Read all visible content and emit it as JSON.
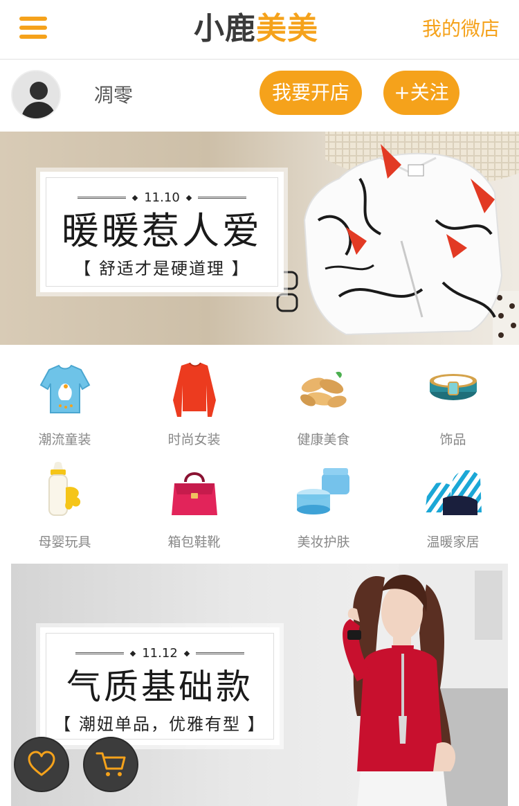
{
  "header": {
    "logo_part1": "小鹿",
    "logo_part2": "美美",
    "my_shop": "我的微店",
    "menu_icon": "hamburger-menu-icon"
  },
  "profile": {
    "name": "凋零",
    "open_shop": "我要开店",
    "follow": "+关注"
  },
  "banner1": {
    "date": "11.10",
    "title": "暖暖惹人爱",
    "subtitle": "【 舒适才是硬道理 】"
  },
  "categories": [
    {
      "label": "潮流童装",
      "icon": "kids-sweater"
    },
    {
      "label": "时尚女装",
      "icon": "red-sweater"
    },
    {
      "label": "健康美食",
      "icon": "cashew-nuts"
    },
    {
      "label": "饰品",
      "icon": "bangle"
    },
    {
      "label": "母婴玩具",
      "icon": "baby-bottle"
    },
    {
      "label": "箱包鞋靴",
      "icon": "handbag"
    },
    {
      "label": "美妆护肤",
      "icon": "cream-jar"
    },
    {
      "label": "温暖家居",
      "icon": "bean-bag"
    }
  ],
  "banner2": {
    "date": "11.12",
    "title": "气质基础款",
    "subtitle": "【 潮妞单品，优雅有型 】"
  },
  "fabs": {
    "favorite_icon": "heart-icon",
    "cart_icon": "shopping-cart-icon"
  },
  "colors": {
    "accent": "#f5a21b",
    "logo_dark": "#3a3a3a",
    "fab_bg": "#3c3c3c"
  }
}
